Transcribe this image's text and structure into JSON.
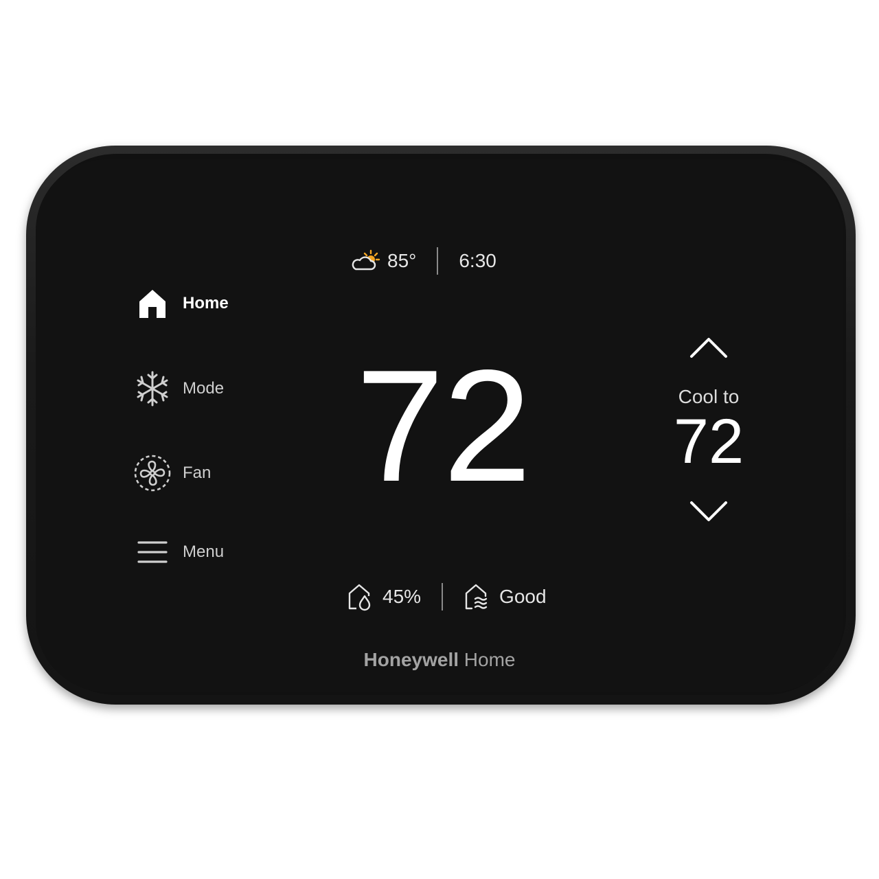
{
  "top_status": {
    "outdoor_temp": "85°",
    "time": "6:30",
    "weather_icon": "partly-sunny-icon",
    "sun_color": "#f5a623"
  },
  "nav": {
    "items": [
      {
        "label": "Home",
        "icon": "home-icon",
        "active": true
      },
      {
        "label": "Mode",
        "icon": "snowflake-icon",
        "active": false
      },
      {
        "label": "Fan",
        "icon": "fan-icon",
        "active": false
      },
      {
        "label": "Menu",
        "icon": "menu-icon",
        "active": false
      }
    ]
  },
  "current_temp": "72",
  "setpoint": {
    "label": "Cool to",
    "value": "72",
    "up_icon": "chevron-up-icon",
    "down_icon": "chevron-down-icon"
  },
  "bottom_status": {
    "humidity": "45%",
    "humidity_icon": "humidity-icon",
    "air_quality": "Good",
    "air_quality_icon": "air-quality-icon"
  },
  "brand": {
    "name": "Honeywell",
    "suffix": "Home"
  },
  "colors": {
    "screen": "#121212",
    "text": "#ffffff",
    "muted": "#cfcfcf"
  }
}
